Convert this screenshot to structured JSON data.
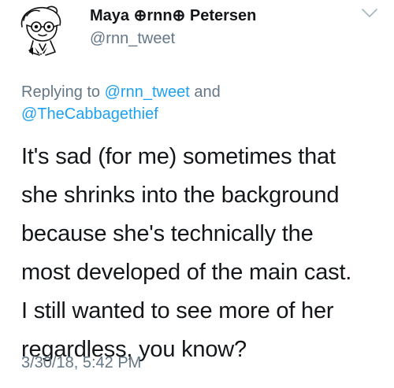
{
  "author": {
    "display_name": "Maya ⊕rnn⊕ Petersen",
    "handle": "@rnn_tweet"
  },
  "icons": {
    "avatar": "avatar-doodle-icon",
    "menu": "chevron-down-icon"
  },
  "reply": {
    "prefix": "Replying to ",
    "mention_1": "@rnn_tweet",
    "joiner": " and",
    "mention_2": "@TheCabbagethief"
  },
  "tweet": {
    "lines": [
      "It's sad (for me) sometimes that",
      "she shrinks into the background",
      "because she's technically the",
      "most developed of the main cast.",
      "I still wanted to see more of her",
      "regardless, you know?"
    ],
    "timestamp": "3/30/18, 5:42 PM"
  },
  "colors": {
    "text": "#14171a",
    "secondary": "#657786",
    "link": "#1da1f2"
  }
}
